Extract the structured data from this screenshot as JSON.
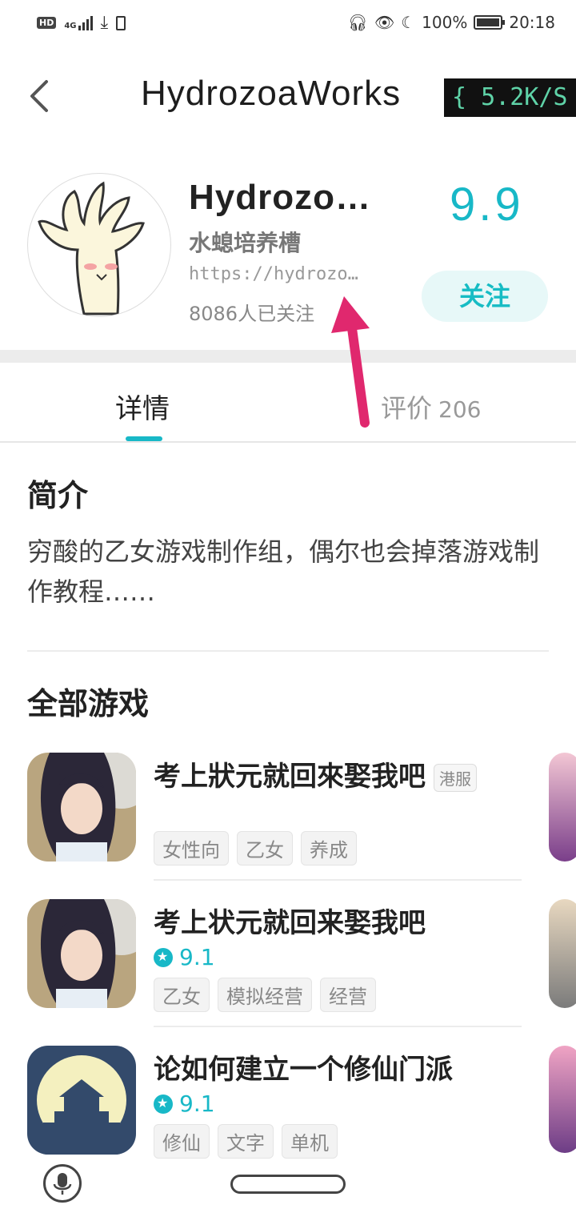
{
  "status_bar": {
    "hd": "HD",
    "network": "4G",
    "battery_pct": "100%",
    "time": "20:18"
  },
  "header": {
    "title": "HydrozoaWorks",
    "net_speed": "{ 5.2K/S"
  },
  "profile": {
    "name": "Hydrozo…",
    "subtitle": "水螅培养槽",
    "url": "https://hydrozo…",
    "followers": "8086人已关注",
    "score": "9.9",
    "follow_label": "关注"
  },
  "tabs": {
    "detail": "详情",
    "review": "评价",
    "review_count": "206"
  },
  "intro": {
    "title": "简介",
    "text": "穷酸的乙女游戏制作组，偶尔也会掉落游戏制作教程……"
  },
  "games": {
    "title": "全部游戏",
    "items": [
      {
        "name": "考上狀元就回來娶我吧",
        "region": "港服",
        "rating": "",
        "tags": [
          "女性向",
          "乙女",
          "养成"
        ]
      },
      {
        "name": "考上状元就回来娶我吧",
        "region": "",
        "rating": "9.1",
        "tags": [
          "乙女",
          "模拟经营",
          "经营"
        ]
      },
      {
        "name": "论如何建立一个修仙门派",
        "region": "",
        "rating": "9.1",
        "tags": [
          "修仙",
          "文字",
          "单机"
        ]
      }
    ]
  },
  "colors": {
    "accent": "#18b8c7",
    "arrow": "#e0286e"
  }
}
